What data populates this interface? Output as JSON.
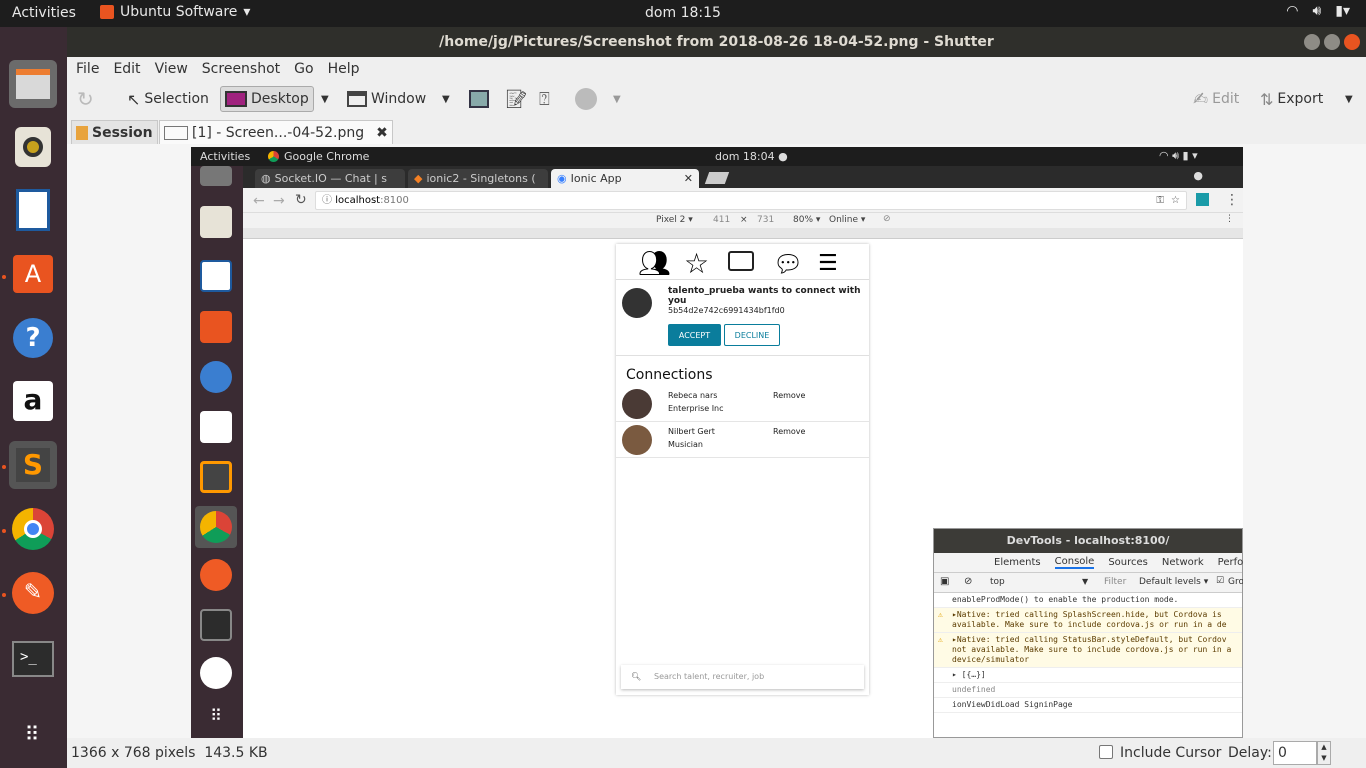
{
  "os": {
    "activities": "Activities",
    "app_name": "Ubuntu Software",
    "clock": "dom 18:15"
  },
  "window": {
    "title": "/home/jg/Pictures/Screenshot from 2018-08-26 18-04-52.png - Shutter"
  },
  "menu": [
    "File",
    "Edit",
    "View",
    "Screenshot",
    "Go",
    "Help"
  ],
  "toolbar": {
    "selection": "Selection",
    "desktop": "Desktop",
    "window": "Window",
    "edit": "Edit",
    "export": "Export"
  },
  "tabs": {
    "session": "Session",
    "file": "[1] - Screen...-04-52.png"
  },
  "status": {
    "info": "1366 x 768 pixels  143.5 KB",
    "include_cursor": "Include Cursor",
    "delay_label": "Delay:",
    "delay_value": "0"
  },
  "inner": {
    "activities": "Activities",
    "app_name": "Google Chrome",
    "clock": "dom 18:04 ●",
    "tabs": [
      "Socket.IO — Chat | s",
      "ionic2 - Singletons (",
      "Ionic App"
    ],
    "url_host": "localhost",
    "url_port": ":8100",
    "device": {
      "model": "Pixel 2 ▾",
      "width": "411",
      "x": "×",
      "height": "731",
      "zoom": "80% ▾",
      "network": "Online ▾"
    },
    "app": {
      "request_text": "talento_prueba wants to connect with you",
      "request_id": "5b54d2e742c6991434bf1fd0",
      "accept": "ACCEPT",
      "decline": "DECLINE",
      "connections_title": "Connections",
      "connections": [
        {
          "name": "Rebeca nars",
          "role": "Enterprise Inc",
          "action": "Remove"
        },
        {
          "name": "Nilbert Gert",
          "role": "Musician",
          "action": "Remove"
        }
      ],
      "search_placeholder": "Search talent, recruiter, job"
    },
    "devtools": {
      "title": "DevTools - localhost:8100/",
      "tabs": [
        "Elements",
        "Console",
        "Sources",
        "Network",
        "Perform"
      ],
      "context": "top",
      "filter": "Filter",
      "levels": "Default levels ▾",
      "group": "Gro",
      "console": [
        {
          "type": "log",
          "text": "enableProdMode() to enable the production mode."
        },
        {
          "type": "warn",
          "text": "▸Native: tried calling SplashScreen.hide, but Cordova is\navailable. Make sure to include cordova.js or run in a de"
        },
        {
          "type": "warn",
          "text": "▸Native: tried calling StatusBar.styleDefault, but Cordov\nnot available. Make sure to include cordova.js or run in a\ndevice/simulator"
        },
        {
          "type": "log",
          "text": "▸ [{…}]"
        },
        {
          "type": "log",
          "text": "undefined"
        },
        {
          "type": "log",
          "text": "ionViewDidLoad SigninPage"
        }
      ]
    }
  },
  "colors": {
    "ubuntu_orange": "#e95420",
    "accept_bg": "#0a7d9c",
    "decline_border": "#0a7d9c"
  }
}
